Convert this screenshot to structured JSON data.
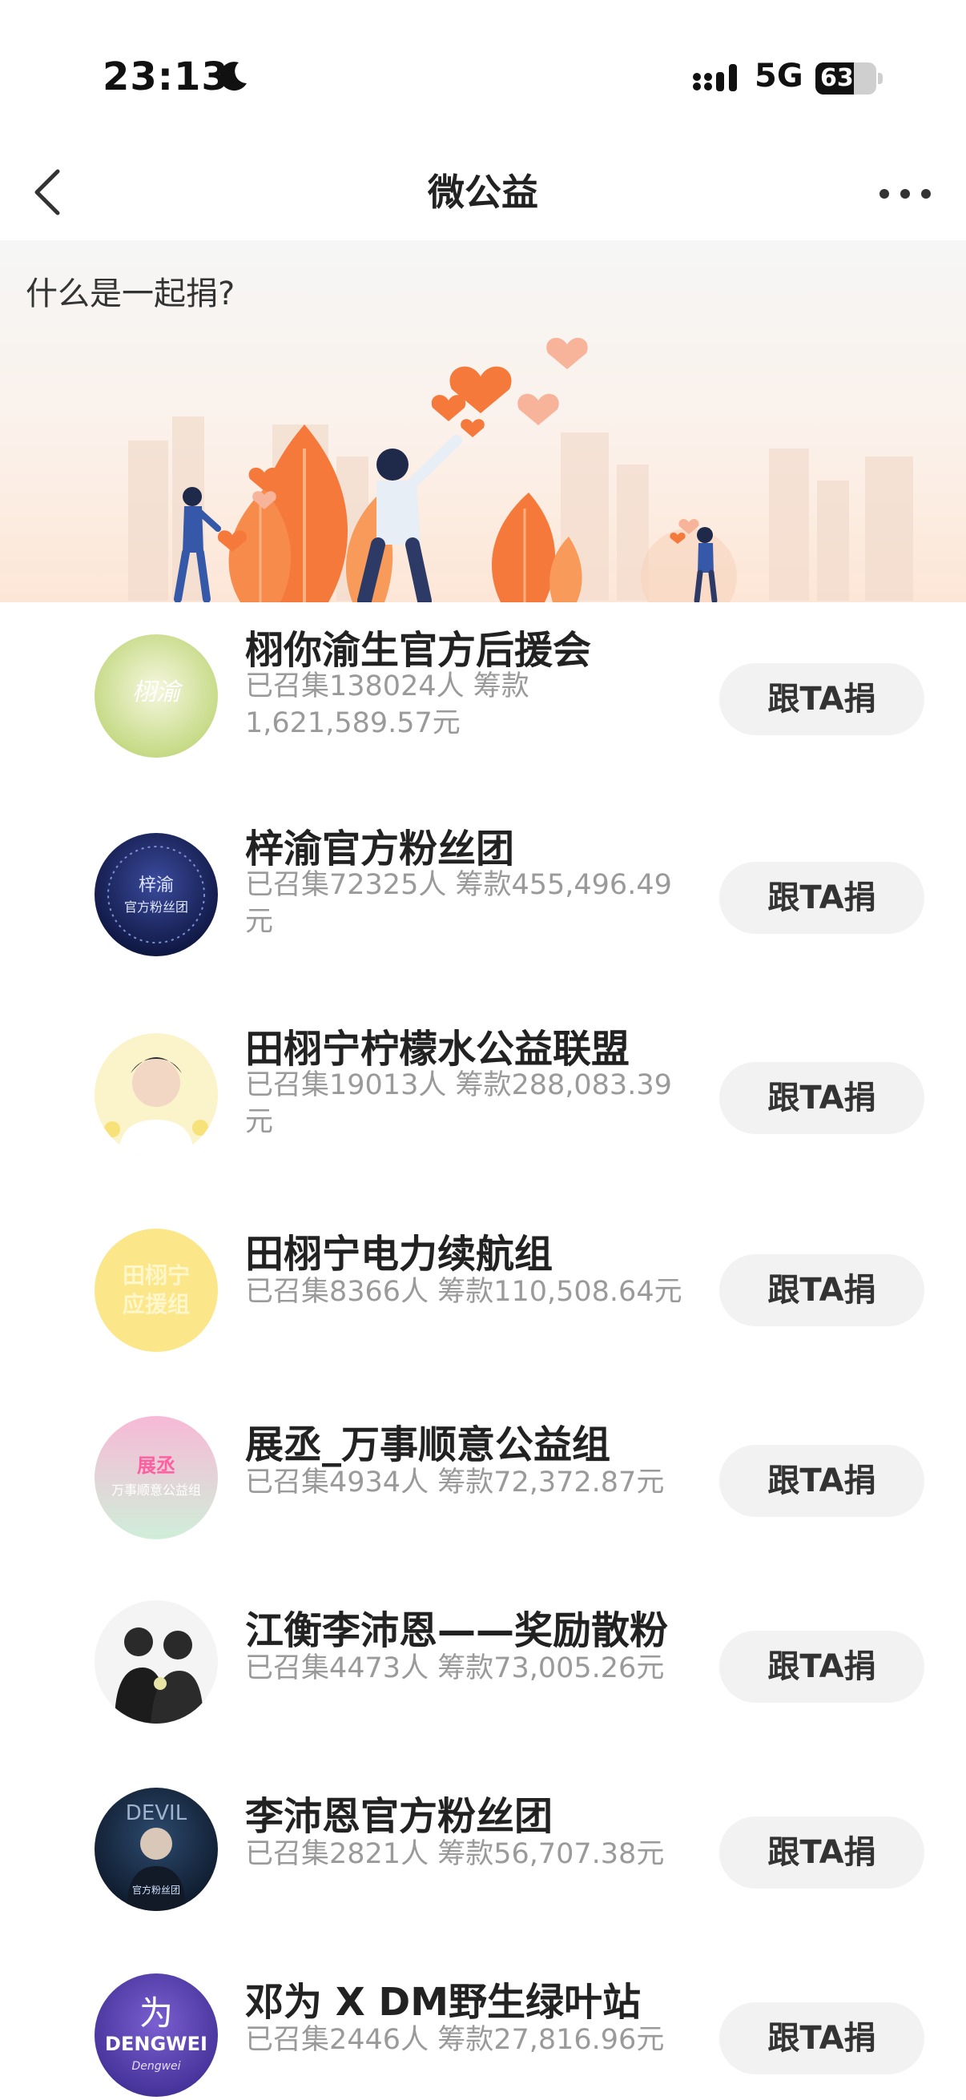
{
  "status_bar": {
    "time": "23:13",
    "network": "5G",
    "battery": "63",
    "battery_level": 0.63,
    "icons": [
      "moon-icon",
      "signal-icon",
      "battery-icon"
    ]
  },
  "nav": {
    "title": "微公益",
    "back_icon": "chevron-left-icon",
    "more_icon": "more-dots-icon"
  },
  "banner": {
    "question": "什么是一起捐?"
  },
  "colors": {
    "accent_orange": "#f5793a",
    "button_bg": "#f2f2f2",
    "secondary_text": "#9a9a9a"
  },
  "items": [
    {
      "name": "栩你渝生官方后援会",
      "stats": "已召集138024人 筹款1,621,589.57元",
      "button": "跟TA捐"
    },
    {
      "name": "梓渝官方粉丝团",
      "stats": "已召集72325人 筹款455,496.49元",
      "button": "跟TA捐"
    },
    {
      "name": "田栩宁柠檬水公益联盟",
      "stats": "已召集19013人 筹款288,083.39元",
      "button": "跟TA捐"
    },
    {
      "name": "田栩宁电力续航组",
      "stats": "已召集8366人 筹款110,508.64元",
      "button": "跟TA捐"
    },
    {
      "name": "展丞_万事顺意公益组",
      "stats": "已召集4934人 筹款72,372.87元",
      "button": "跟TA捐"
    },
    {
      "name": "江衡李沛恩——奖励散粉",
      "stats": "已召集4473人 筹款73,005.26元",
      "button": "跟TA捐"
    },
    {
      "name": "李沛恩官方粉丝团",
      "stats": "已召集2821人 筹款56,707.38元",
      "button": "跟TA捐"
    },
    {
      "name": "邓为 X DM野生绿叶站",
      "stats": "已召集2446人 筹款27,816.96元",
      "button": "跟TA捐"
    }
  ]
}
